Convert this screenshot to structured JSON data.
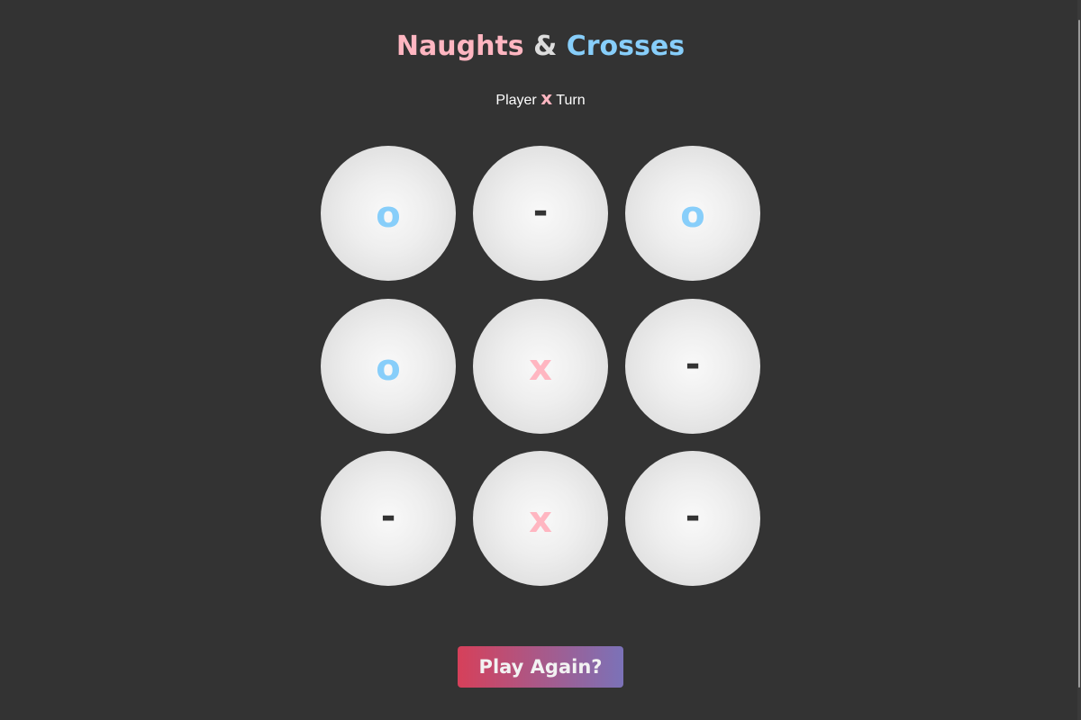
{
  "title": {
    "part1": "Naughts",
    "amp": "&",
    "part2": "Crosses"
  },
  "status": {
    "prefix": "Player",
    "player": "x",
    "suffix": "Turn"
  },
  "board": {
    "cells": [
      "o",
      "-",
      "o",
      "o",
      "x",
      "-",
      "-",
      "x",
      "-"
    ]
  },
  "play_again": {
    "label": "Play Again?"
  },
  "colors": {
    "naught": "#87cefa",
    "cross": "#ffb6c1",
    "background": "#333333",
    "button_gradient_start": "#d6405a",
    "button_gradient_end": "#7b72b8"
  }
}
